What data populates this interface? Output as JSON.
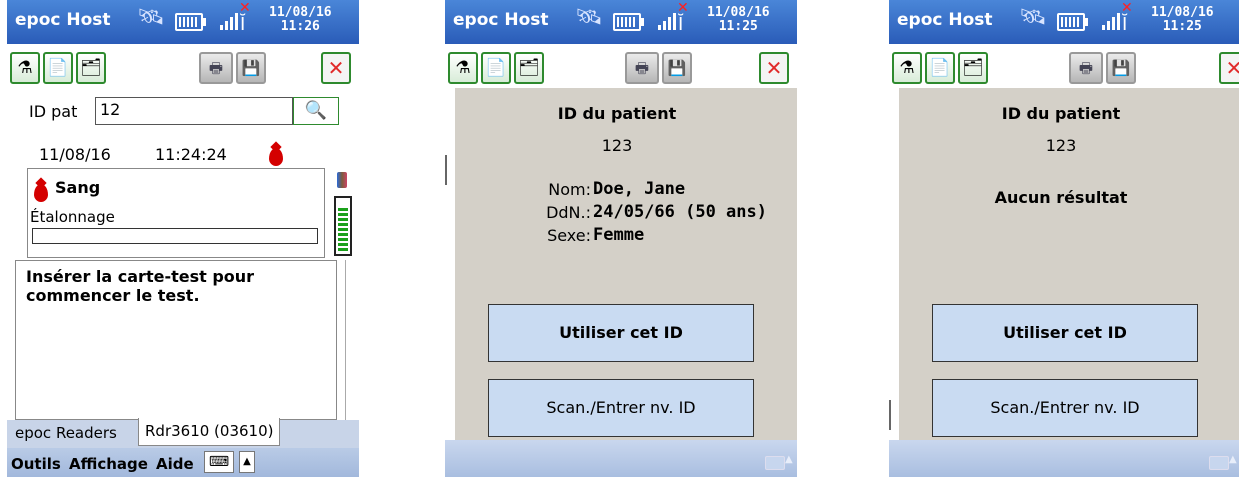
{
  "common": {
    "app_title": "epoc Host",
    "date": "11/08/16",
    "glyphs": {
      "wand": "🛰",
      "antenna": "Ĭ",
      "x": "✕",
      "search": "🔍",
      "up_arrow": "▲",
      "kbd": "⌨",
      "close": "✕",
      "toolbar1": "⚗",
      "toolbar2": "📄",
      "toolbar3": "🗂",
      "print": "🖶",
      "save": "💾"
    }
  },
  "screen1": {
    "time": "11:26",
    "id_label": "ID pat",
    "id_value": "12",
    "test_date": "11/08/16",
    "test_time": "11:24:24",
    "sample_type": "Sang",
    "calibration_label": "Étalonnage",
    "calibration_progress": 0.0,
    "message": "Insérer la carte-test pour commencer le test.",
    "tab_readers": "epoc Readers",
    "tab_reader_active": "Rdr3610 (03610)",
    "menu": [
      "Outils",
      "Affichage",
      "Aide"
    ]
  },
  "screen2": {
    "time": "11:25",
    "dialog_title": "ID du patient",
    "patient_id": "123",
    "name_label": "Nom:",
    "name_value": "Doe, Jane",
    "dob_label": "DdN.:",
    "dob_value": "24/05/66 (50 ans)",
    "sex_label": "Sexe:",
    "sex_value": "Femme",
    "btn_use": "Utiliser cet ID",
    "btn_scan": "Scan./Entrer nv. ID"
  },
  "screen3": {
    "time": "11:25",
    "dialog_title": "ID du patient",
    "patient_id": "123",
    "no_result": "Aucun résultat",
    "btn_use": "Utiliser cet ID",
    "btn_scan": "Scan./Entrer nv. ID"
  }
}
